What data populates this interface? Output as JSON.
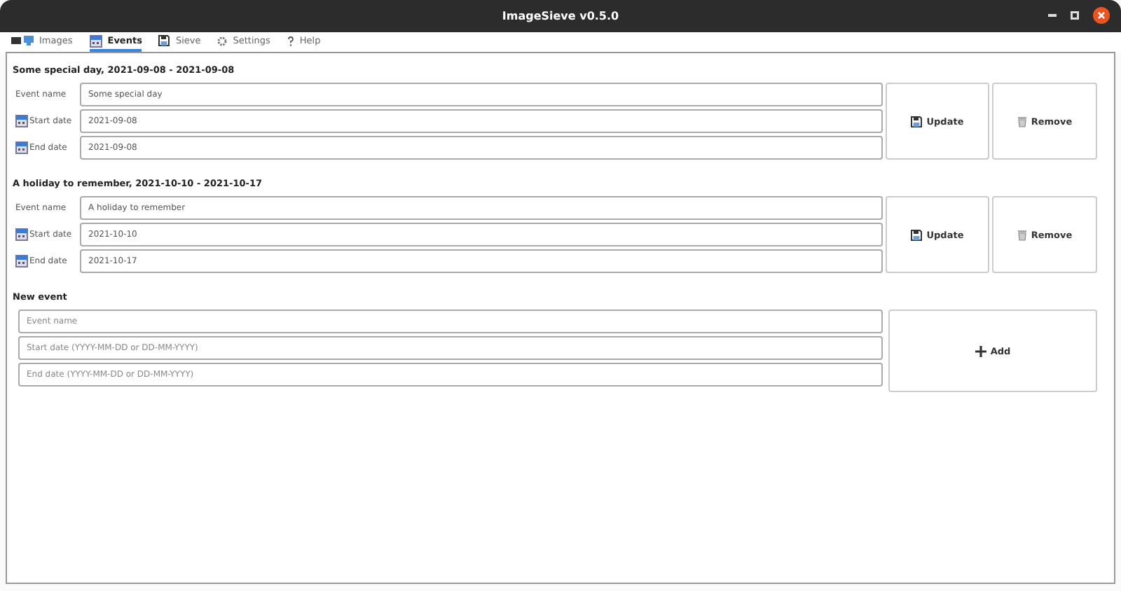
{
  "window": {
    "title": "ImageSieve v0.5.0"
  },
  "tabs": [
    {
      "label": "Images",
      "selected": false
    },
    {
      "label": "Events",
      "selected": true
    },
    {
      "label": "Sieve",
      "selected": false
    },
    {
      "label": "Settings",
      "selected": false
    },
    {
      "label": "Help",
      "selected": false
    }
  ],
  "events": [
    {
      "heading": "Some special day, 2021-09-08 - 2021-09-08",
      "fields": [
        {
          "kind": "text",
          "label": "Event name",
          "value": "Some special day"
        },
        {
          "kind": "date",
          "label": "Start date",
          "value": "2021-09-08"
        },
        {
          "kind": "date",
          "label": "End date",
          "value": "2021-09-08"
        }
      ],
      "update": "Update",
      "remove": "Remove"
    },
    {
      "heading": "A holiday to remember, 2021-10-10 - 2021-10-17",
      "fields": [
        {
          "kind": "text",
          "label": "Event name",
          "value": "A holiday to remember"
        },
        {
          "kind": "date",
          "label": "Start date",
          "value": "2021-10-10"
        },
        {
          "kind": "date",
          "label": "End date",
          "value": "2021-10-17"
        }
      ],
      "update": "Update",
      "remove": "Remove"
    }
  ],
  "new_event": {
    "heading": "New event",
    "fields": [
      {
        "placeholder": "Event name"
      },
      {
        "placeholder": "Start date (YYYY-MM-DD or DD-MM-YYYY)"
      },
      {
        "placeholder": "End date (YYYY-MM-DD or DD-MM-YYYY)"
      }
    ],
    "add": "Add"
  }
}
